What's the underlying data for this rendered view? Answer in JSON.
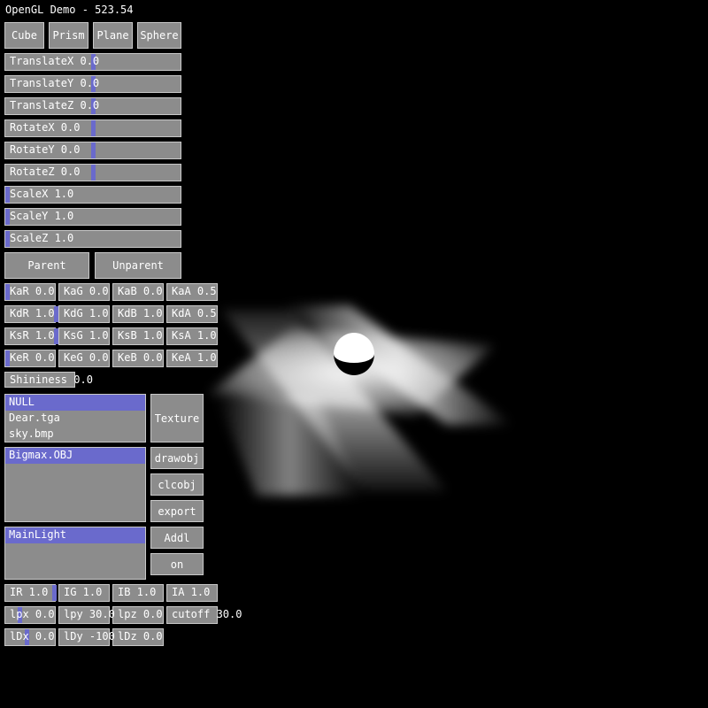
{
  "window": {
    "title": "OpenGL Demo - 523.54"
  },
  "shape_buttons": [
    {
      "id": "cube",
      "label": "Cube"
    },
    {
      "id": "prism",
      "label": "Prism"
    },
    {
      "id": "plane",
      "label": "Plane"
    },
    {
      "id": "sphere",
      "label": "Sphere"
    }
  ],
  "transform_sliders": [
    {
      "label": "TranslateX 0.0",
      "level": 0.5
    },
    {
      "label": "TranslateY 0.0",
      "level": 0.5
    },
    {
      "label": "TranslateZ 0.0",
      "level": 0.5
    },
    {
      "label": "RotateX 0.0",
      "level": 0.5
    },
    {
      "label": "RotateY 0.0",
      "level": 0.5
    },
    {
      "label": "RotateZ 0.0",
      "level": 0.5
    },
    {
      "label": "ScaleX 1.0",
      "level": 0.0
    },
    {
      "label": "ScaleY 1.0",
      "level": 0.0
    },
    {
      "label": "ScaleZ 1.0",
      "level": 0.0
    }
  ],
  "parent_buttons": {
    "parent": "Parent",
    "unparent": "Unparent"
  },
  "material": {
    "ka": [
      "KaR 0.0",
      "KaG 0.0",
      "KaB 0.0",
      "KaA 0.5"
    ],
    "kd": [
      "KdR 1.0",
      "KdG 1.0",
      "KdB 1.0",
      "KdA 0.5"
    ],
    "ks": [
      "KsR 1.0",
      "KsG 1.0",
      "KsB 1.0",
      "KsA 1.0"
    ],
    "ke": [
      "KeR 0.0",
      "KeG 0.0",
      "KeB 0.0",
      "KeA 1.0"
    ],
    "shininess": "Shininess 0.0"
  },
  "textures": {
    "items": [
      "NULL",
      "Dear.tga",
      "sky.bmp"
    ],
    "selected": 0,
    "button": "Texture"
  },
  "objects": {
    "items": [
      "Bigmax.OBJ"
    ],
    "selected": 0
  },
  "object_buttons": {
    "drawobj": "drawobj",
    "clcobj": "clcobj",
    "export": "export"
  },
  "lights": {
    "items": [
      "MainLight"
    ],
    "selected": 0
  },
  "light_buttons": {
    "addl": "Addl",
    "on": "on"
  },
  "light_intensity": [
    "IR 1.0",
    "IG 1.0",
    "IB 1.0",
    "IA 1.0"
  ],
  "light_position": [
    "lpx 0.0",
    "lpy 30.0",
    "lpz 0.0",
    "cutoff 30.0"
  ],
  "light_direction": [
    "lDx 0.0",
    "lDy -100",
    "lDz 0.0"
  ],
  "colors": {
    "panel": "#8c8c8c",
    "accent": "#6a6acc",
    "background": "#000000"
  }
}
